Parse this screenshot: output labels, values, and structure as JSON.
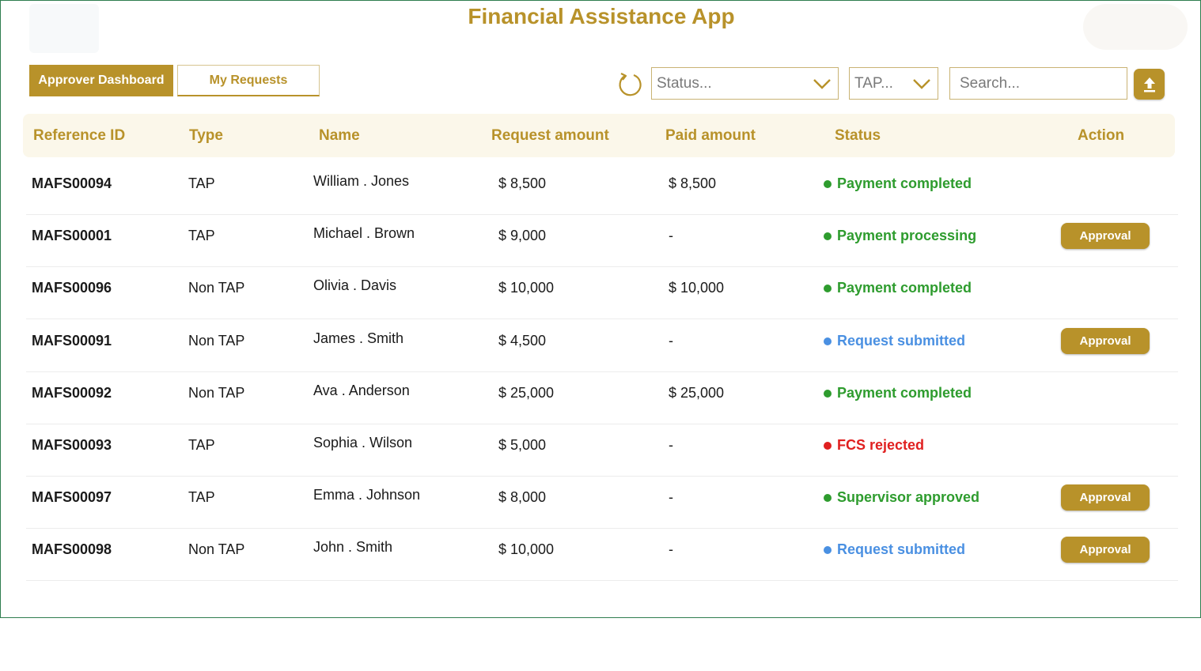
{
  "app": {
    "title": "Financial Assistance App"
  },
  "tabs": [
    {
      "label": "Approver Dashboard",
      "active": true
    },
    {
      "label": "My Requests",
      "active": false
    }
  ],
  "toolbar": {
    "refresh_icon": "refresh-icon",
    "status_filter": {
      "placeholder": "Status..."
    },
    "type_filter": {
      "placeholder": "TAP..."
    },
    "search": {
      "placeholder": "Search..."
    },
    "upload_icon": "upload-icon"
  },
  "colors": {
    "accent": "#b8922a",
    "header_bg": "#fbf7ea",
    "status_green": "#2e9c2e",
    "status_blue": "#4a90e2",
    "status_red": "#e02020"
  },
  "table": {
    "headers": [
      "Reference ID",
      "Type",
      "Name",
      "Request amount",
      "Paid amount",
      "Status",
      "Action"
    ],
    "rows": [
      {
        "ref": "MAFS00094",
        "type": "TAP",
        "name": "William . Jones",
        "request": "$ 8,500",
        "paid": "$ 8,500",
        "status": "Payment completed",
        "status_color": "green",
        "action": ""
      },
      {
        "ref": "MAFS00001",
        "type": "TAP",
        "name": "Michael  . Brown",
        "request": "$ 9,000",
        "paid": "-",
        "status": "Payment processing",
        "status_color": "green",
        "action": "Approval"
      },
      {
        "ref": "MAFS00096",
        "type": "Non TAP",
        "name": "Olivia  . Davis",
        "request": "$ 10,000",
        "paid": "$ 10,000",
        "status": "Payment completed",
        "status_color": "green",
        "action": ""
      },
      {
        "ref": "MAFS00091",
        "type": "Non TAP",
        "name": "James . Smith",
        "request": "$ 4,500",
        "paid": "-",
        "status": "Request submitted",
        "status_color": "blue",
        "action": "Approval"
      },
      {
        "ref": "MAFS00092",
        "type": "Non TAP",
        "name": "Ava . Anderson",
        "request": "$ 25,000",
        "paid": "$ 25,000",
        "status": "Payment completed",
        "status_color": "green",
        "action": ""
      },
      {
        "ref": "MAFS00093",
        "type": "TAP",
        "name": "Sophia . Wilson",
        "request": "$ 5,000",
        "paid": "-",
        "status": "FCS rejected",
        "status_color": "red",
        "action": ""
      },
      {
        "ref": "MAFS00097",
        "type": "TAP",
        "name": "Emma . Johnson",
        "request": "$ 8,000",
        "paid": "-",
        "status": "Supervisor approved",
        "status_color": "green",
        "action": "Approval"
      },
      {
        "ref": "MAFS00098",
        "type": "Non TAP",
        "name": "John . Smith",
        "request": "$ 10,000",
        "paid": "-",
        "status": "Request submitted",
        "status_color": "blue",
        "action": "Approval"
      }
    ]
  }
}
